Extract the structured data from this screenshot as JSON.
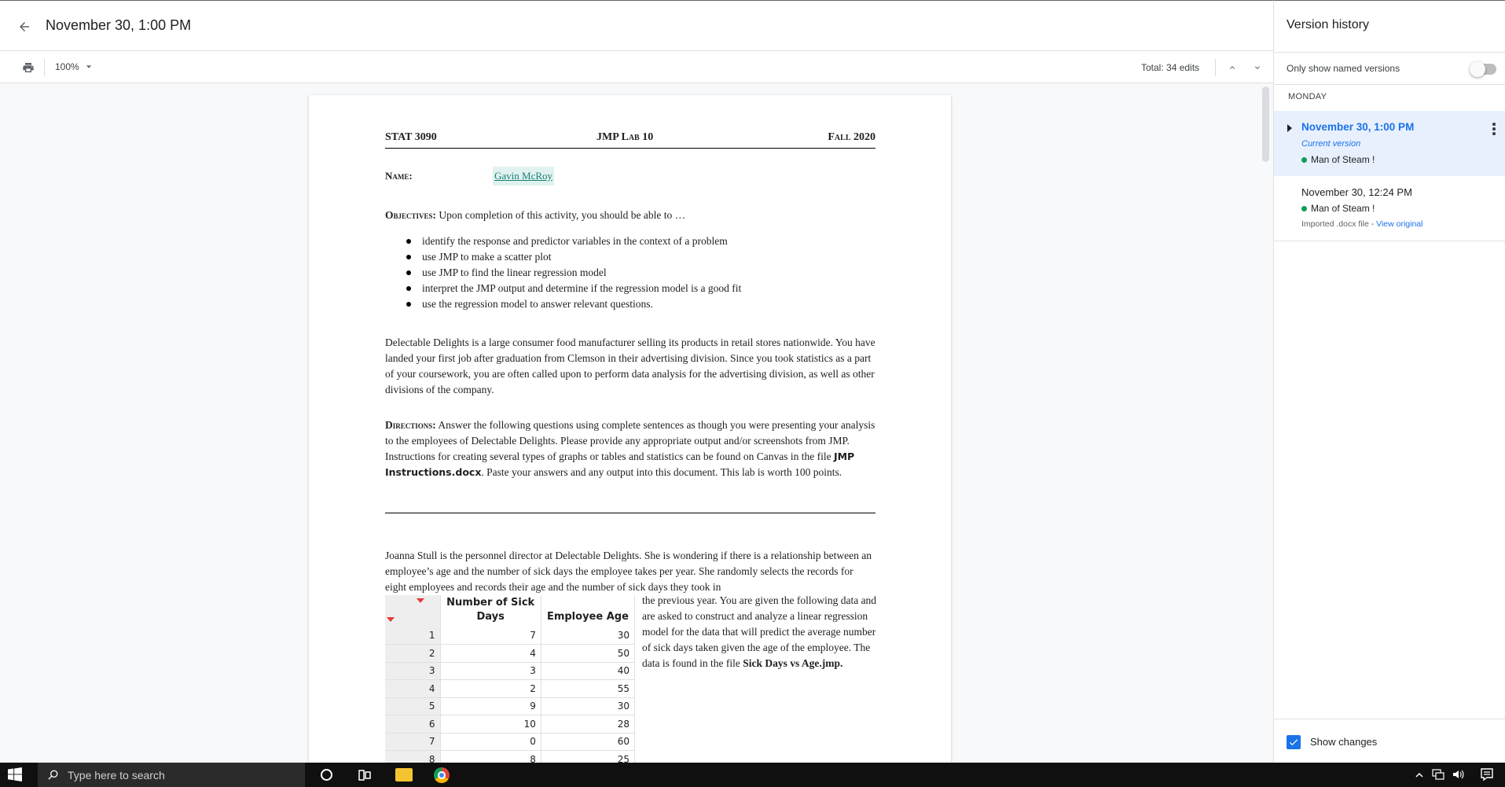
{
  "header": {
    "version_title": "November 30, 1:00 PM"
  },
  "toolbar": {
    "zoom": "100%",
    "total_edits": "Total: 34 edits"
  },
  "document": {
    "course": "STAT 3090",
    "lab": "JMP Lab 10",
    "term": "Fall 2020",
    "name_label": "Name:",
    "name_value": "Gavin McRoy",
    "objectives_label": "Objectives:",
    "objectives_text": " Upon completion of this activity, you should be able to …",
    "objectives": [
      "identify the response and predictor variables in the context of a problem",
      "use JMP to make a scatter plot",
      "use JMP to find the linear regression model",
      "interpret the JMP output and determine if the regression model is a good fit",
      "use the regression model to answer relevant questions."
    ],
    "intro": "Delectable Delights is a large consumer food manufacturer selling its products in retail stores nationwide.  You have landed your first job after graduation from Clemson in their advertising division.  Since you took statistics as a part of your coursework, you are often called upon to perform data analysis for the advertising division, as well as other divisions of the company.",
    "directions_label": "Directions:",
    "directions_text_1": " Answer the following questions using complete sentences as though you were presenting your analysis to the employees of Delectable Delights. Please provide any appropriate output and/or screenshots from JMP. Instructions for creating several types of graphs or tables and statistics can be found on Canvas in the file ",
    "directions_file": "JMP Instructions.docx",
    "directions_text_2": ". Paste your answers and any output into this document.  This lab is worth 100 points.",
    "story": "Joanna Stull is the personnel director at Delectable Delights.  She is wondering if there is a relationship between an employee’s age and the number of sick days the employee takes per year.  She randomly selects the records for eight employees and records their age and the number of sick days they took in",
    "story_cont": "the previous year.  You are given the following data and are asked to construct and analyze a linear regression model for the data that will predict the average number of sick days taken given the age of the employee.  The data is found in the file ",
    "story_file": "Sick Days vs Age.jmp.",
    "table": {
      "col1_line1": "Number of Sick",
      "col1_line2": "Days",
      "col2": "Employee Age",
      "rows": [
        [
          "1",
          "7",
          "30"
        ],
        [
          "2",
          "4",
          "50"
        ],
        [
          "3",
          "3",
          "40"
        ],
        [
          "4",
          "2",
          "55"
        ],
        [
          "5",
          "9",
          "30"
        ],
        [
          "6",
          "10",
          "28"
        ],
        [
          "7",
          "0",
          "60"
        ],
        [
          "8",
          "8",
          "25"
        ]
      ]
    }
  },
  "panel": {
    "title": "Version history",
    "named_only_label": "Only show named versions",
    "day_label": "MONDAY",
    "versions": [
      {
        "time": "November 30, 1:00 PM",
        "status": "Current version",
        "author": "Man of Steam !"
      },
      {
        "time": "November 30, 12:24 PM",
        "author": "Man of Steam !",
        "note": "Imported .docx file - ",
        "link": "View original"
      }
    ],
    "show_changes_label": "Show changes"
  },
  "taskbar": {
    "search_placeholder": "Type here to search"
  },
  "colors": {
    "accent": "#1a73e8",
    "selected_bg": "#e8f0fe",
    "author_dot": "#0f9d58",
    "highlight": "#e0f2ef"
  }
}
